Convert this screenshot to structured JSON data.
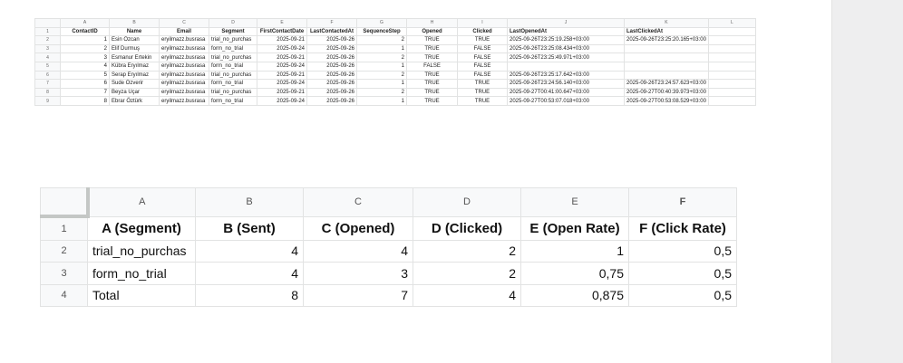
{
  "sheet_top": {
    "columns": [
      "A",
      "B",
      "C",
      "D",
      "E",
      "F",
      "G",
      "H",
      "I",
      "J",
      "K",
      "L"
    ],
    "row_numbers": [
      "1",
      "2",
      "3",
      "4",
      "5",
      "6",
      "7",
      "8",
      "9"
    ],
    "headers": [
      "ContactID",
      "Name",
      "Email",
      "Segment",
      "FirstContactDate",
      "LastContactedAt",
      "SequenceStep",
      "Opened",
      "Clicked",
      "LastOpenedAt",
      "LastClickedAt",
      ""
    ],
    "rows": [
      [
        "1",
        "Esin Özcan",
        "eryilmazz.busrasa",
        "trial_no_purchas",
        "2025-09-21",
        "2025-09-26",
        "2",
        "TRUE",
        "TRUE",
        "2025-09-26T23:25:19.258+03:00",
        "2025-09-26T23:25:20.165+03:00",
        ""
      ],
      [
        "2",
        "Elif Durmuş",
        "eryilmazz.busrasa",
        "form_no_trial",
        "2025-09-24",
        "2025-09-26",
        "1",
        "TRUE",
        "FALSE",
        "2025-09-26T23:25:08.434+03:00",
        "",
        ""
      ],
      [
        "3",
        "Esmanur Ertekin",
        "eryilmazz.busrasa",
        "trial_no_purchas",
        "2025-09-21",
        "2025-09-26",
        "2",
        "TRUE",
        "FALSE",
        "2025-09-26T23:25:49.971+03:00",
        "",
        ""
      ],
      [
        "4",
        "Kübra Eryılmaz",
        "eryilmazz.busrasa",
        "form_no_trial",
        "2025-09-24",
        "2025-09-26",
        "1",
        "FALSE",
        "FALSE",
        "",
        "",
        ""
      ],
      [
        "5",
        "Serap Eryılmaz",
        "eryilmazz.busrasa",
        "trial_no_purchas",
        "2025-09-21",
        "2025-09-26",
        "2",
        "TRUE",
        "FALSE",
        "2025-09-26T23:25:17.642+03:00",
        "",
        ""
      ],
      [
        "6",
        "Sude Özverir",
        "eryilmazz.busrasa",
        "form_no_trial",
        "2025-09-24",
        "2025-09-26",
        "1",
        "TRUE",
        "TRUE",
        "2025-09-26T23:24:56.140+03:00",
        "2025-09-26T23:24:57.623+03:00",
        ""
      ],
      [
        "7",
        "Beyza Uçar",
        "eryilmazz.busrasa",
        "trial_no_purchas",
        "2025-09-21",
        "2025-09-26",
        "2",
        "TRUE",
        "TRUE",
        "2025-09-27T00:41:00.647+03:00",
        "2025-09-27T00:40:39.973+03:00",
        ""
      ],
      [
        "8",
        "Ebrar Öztürk",
        "eryilmazz.busrasa",
        "form_no_trial",
        "2025-09-24",
        "2025-09-26",
        "1",
        "TRUE",
        "TRUE",
        "2025-09-27T00:53:07.018+03:00",
        "2025-09-27T00:53:08.529+03:00",
        ""
      ]
    ]
  },
  "sheet_bottom": {
    "columns": [
      "A",
      "B",
      "C",
      "D",
      "E",
      "F"
    ],
    "row_numbers": [
      "1",
      "2",
      "3",
      "4"
    ],
    "headers": [
      "A (Segment)",
      "B (Sent)",
      "C (Opened)",
      "D (Clicked)",
      "E (Open Rate)",
      "F (Click Rate)"
    ],
    "rows": [
      [
        "trial_no_purchas",
        "4",
        "4",
        "2",
        "1",
        "0,5"
      ],
      [
        "form_no_trial",
        "4",
        "3",
        "2",
        "0,75",
        "0,5"
      ],
      [
        "Total",
        "8",
        "7",
        "4",
        "0,875",
        "0,5"
      ]
    ]
  },
  "colors": {
    "header_bg": "#f8f9fa",
    "selected_header": "#d3e3fd",
    "grid": "#e2e3e3",
    "side_panel": "#eeeeef"
  }
}
